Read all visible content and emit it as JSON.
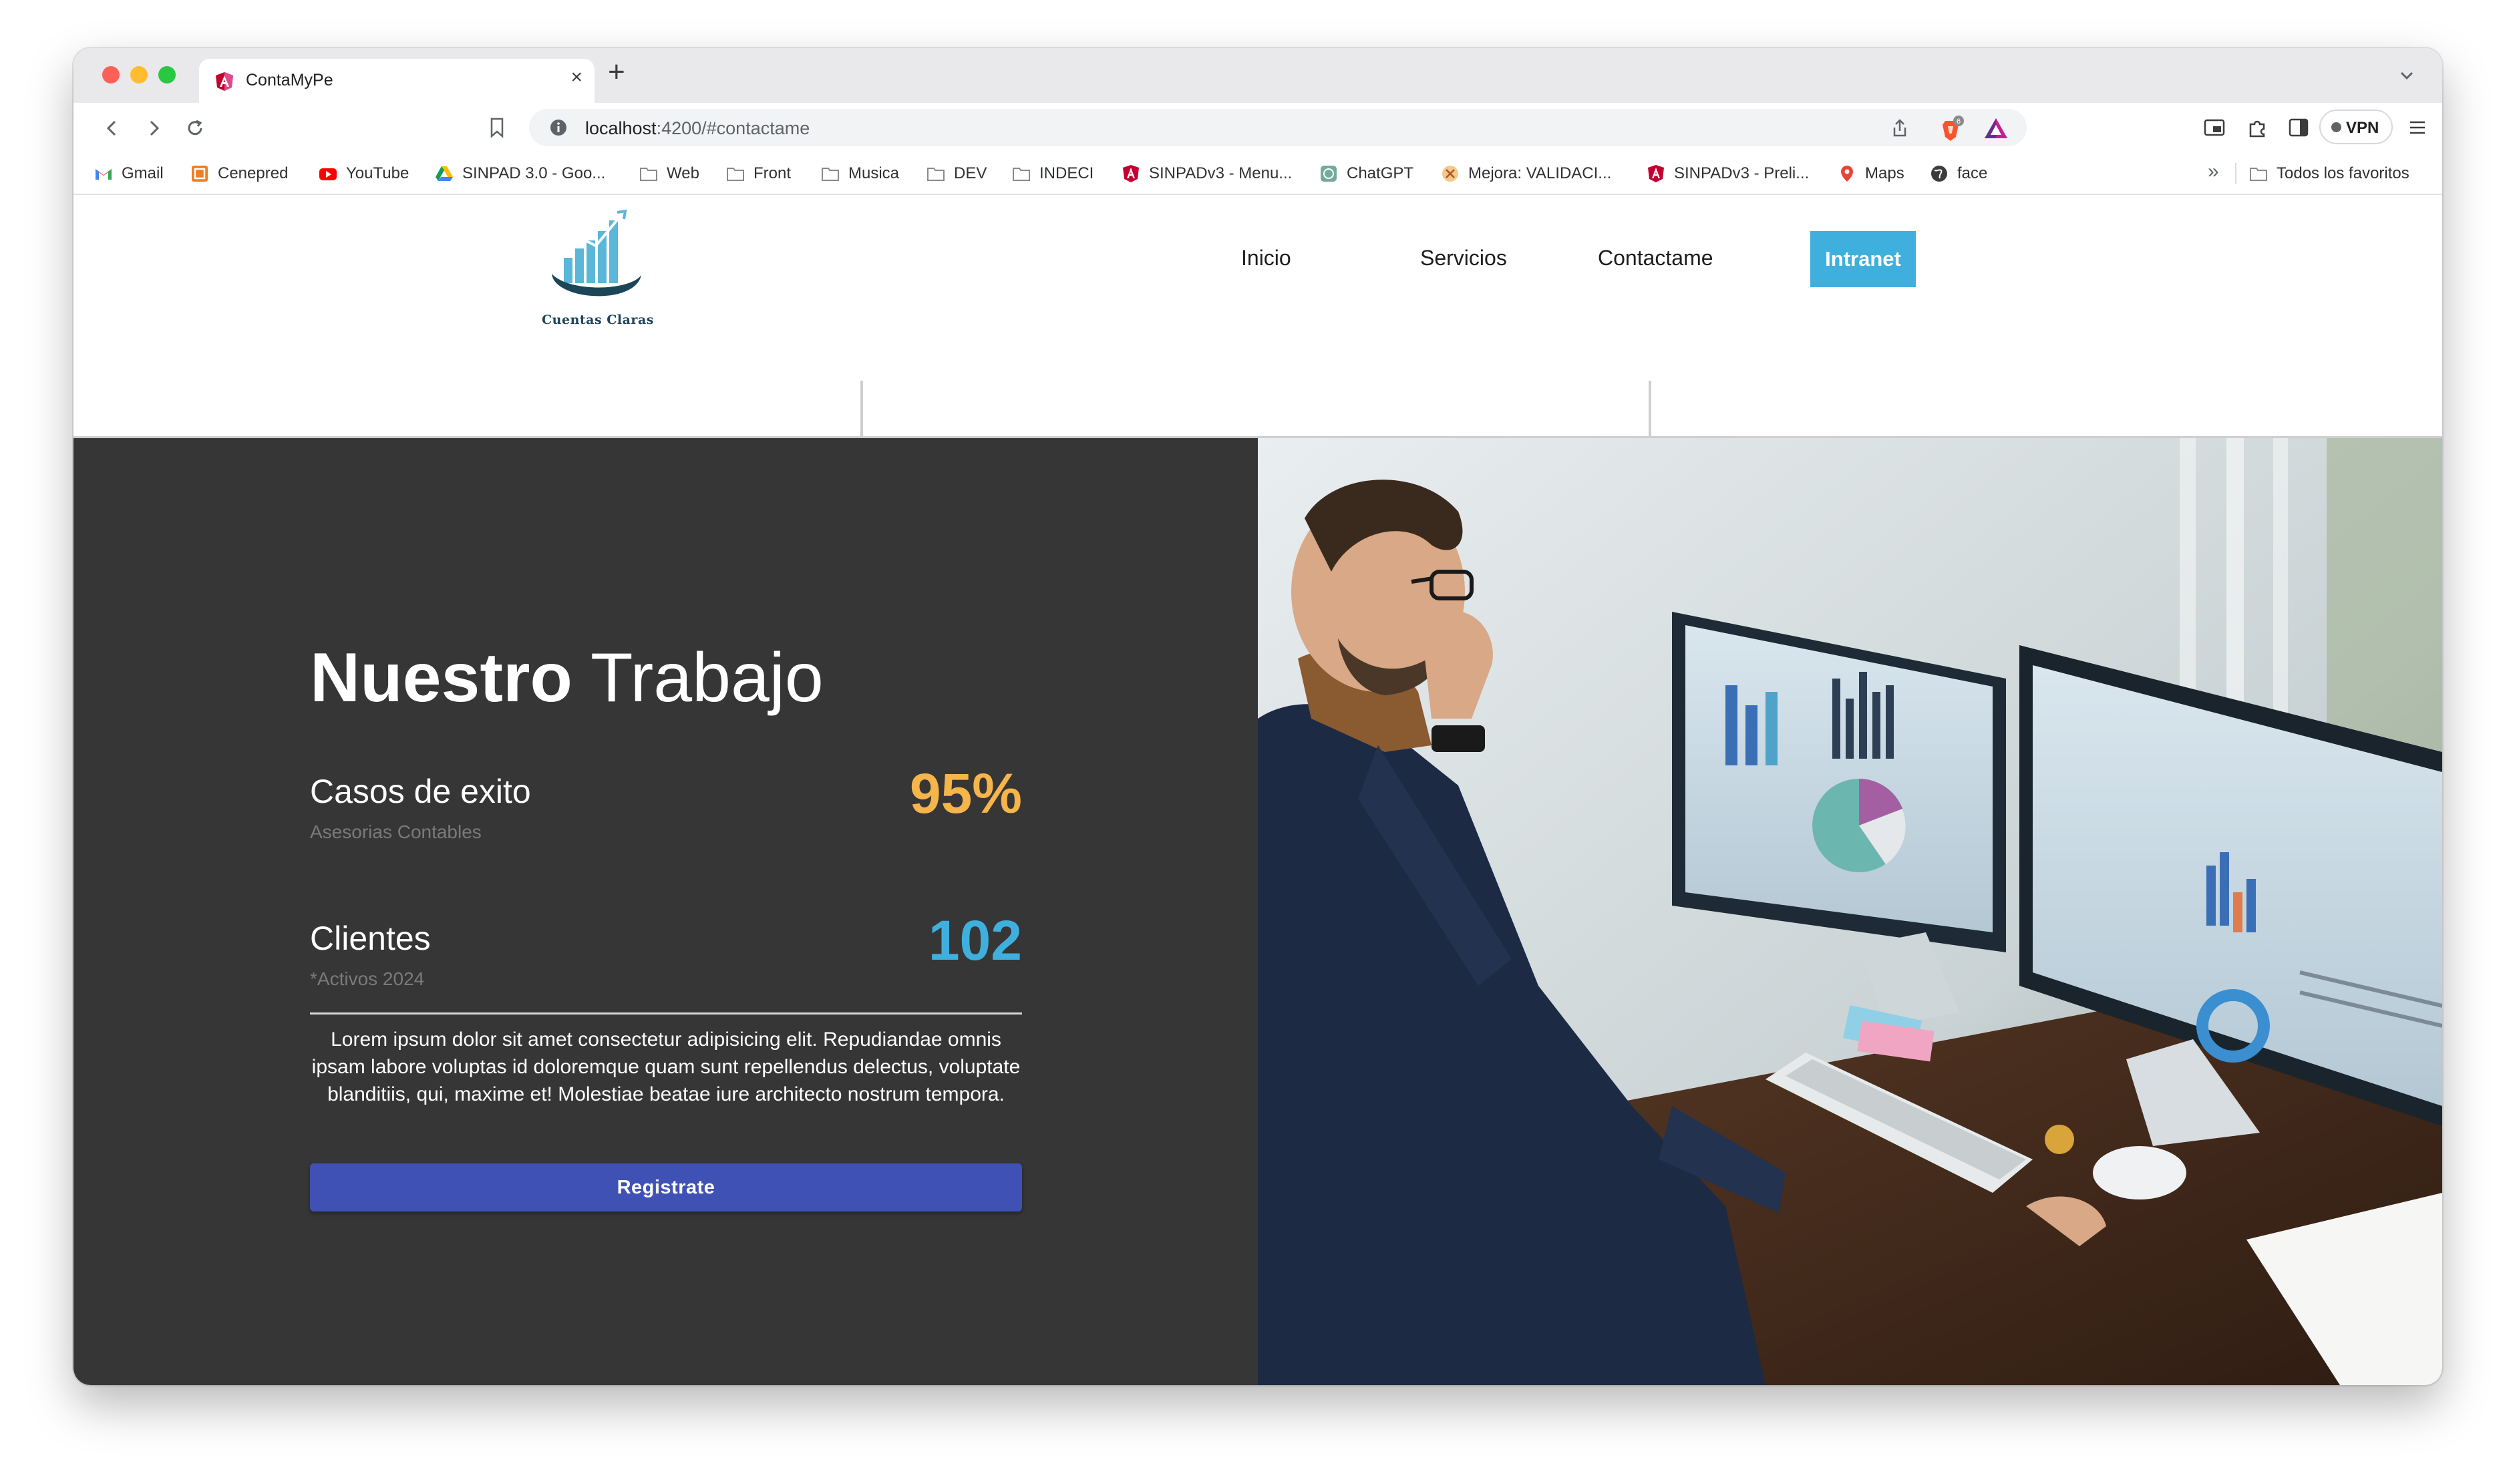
{
  "browser": {
    "tab_title": "ContaMyPe",
    "new_tab_label": "+",
    "close_tab_label": "×",
    "url_host": "localhost",
    "url_path": ":4200/#contactame",
    "vpn_label": "VPN",
    "brave_badge": "6",
    "bookmarks": [
      {
        "label": "Gmail",
        "icon": "gmail-icon"
      },
      {
        "label": "Cenepred",
        "icon": "cenepred-icon"
      },
      {
        "label": "YouTube",
        "icon": "youtube-icon"
      },
      {
        "label": "SINPAD 3.0 - Goo...",
        "icon": "google-drive-icon"
      },
      {
        "label": "Web",
        "icon": "folder-icon"
      },
      {
        "label": "Front",
        "icon": "folder-icon"
      },
      {
        "label": "Musica",
        "icon": "folder-icon"
      },
      {
        "label": "DEV",
        "icon": "folder-icon"
      },
      {
        "label": "INDECI",
        "icon": "folder-icon"
      },
      {
        "label": "SINPADv3 - Menu...",
        "icon": "angular-icon"
      },
      {
        "label": "ChatGPT",
        "icon": "chatgpt-icon"
      },
      {
        "label": "Mejora: VALIDACI...",
        "icon": "mejora-icon"
      },
      {
        "label": "SINPADv3 - Preli...",
        "icon": "angular-icon"
      },
      {
        "label": "Maps",
        "icon": "maps-pin-icon"
      },
      {
        "label": "face",
        "icon": "globe-icon"
      }
    ],
    "more_bookmarks": "»",
    "all_favorites": "Todos los favoritos"
  },
  "site": {
    "logo_text": "Cuentas Claras",
    "nav": [
      "Inicio",
      "Servicios",
      "Contactame"
    ],
    "intranet_label": "Intranet"
  },
  "hero": {
    "title_bold": "Nuestro",
    "title_light": "Trabajo",
    "stats": [
      {
        "label": "Casos de exito",
        "sub": "Asesorias Contables",
        "value": "95%",
        "color": "#f5b54a"
      },
      {
        "label": "Clientes",
        "sub": "*Activos 2024",
        "value": "102",
        "color": "#3fb0de"
      }
    ],
    "description": "Lorem ipsum dolor sit amet consectetur adipisicing elit. Repudiandae omnis ipsam labore voluptas id doloremque quam sunt repellendus delectus, voluptate blanditiis, qui, maxime et! Molestiae beatae iure architecto nostrum tempora.",
    "register_label": "Registrate"
  },
  "colors": {
    "dark_panel": "#363636",
    "accent_blue": "#3fb0de",
    "accent_orange": "#f5b54a",
    "button_indigo": "#3f51b5"
  }
}
